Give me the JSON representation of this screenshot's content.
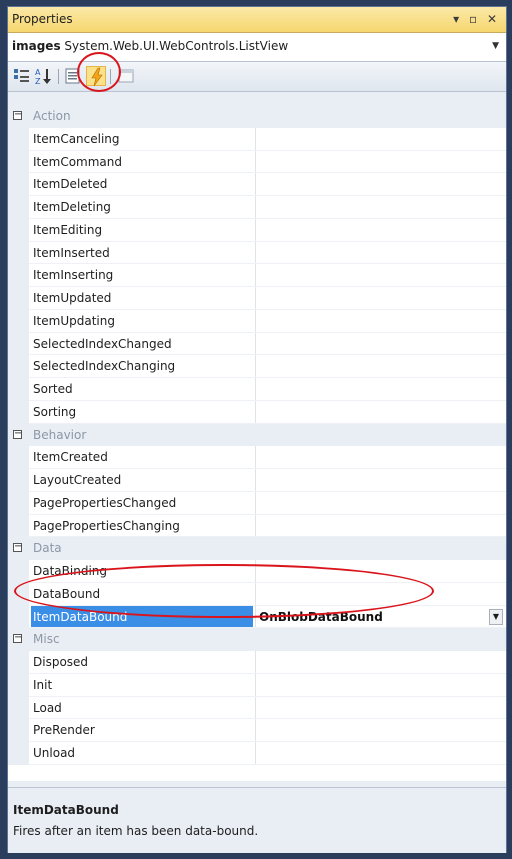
{
  "window": {
    "title": "Properties",
    "controls": "▾ ▫ ✕"
  },
  "object_selector": {
    "name": "images",
    "type": "System.Web.UI.WebControls.ListView"
  },
  "toolbar": {
    "buttons": [
      "categorized-icon",
      "alphabetical-icon",
      "properties-icon",
      "events-icon",
      "property-pages-icon"
    ],
    "active": "events-icon"
  },
  "grid": {
    "categories": [
      {
        "label": "Action",
        "items": [
          {
            "name": "ItemCanceling",
            "value": ""
          },
          {
            "name": "ItemCommand",
            "value": ""
          },
          {
            "name": "ItemDeleted",
            "value": ""
          },
          {
            "name": "ItemDeleting",
            "value": ""
          },
          {
            "name": "ItemEditing",
            "value": ""
          },
          {
            "name": "ItemInserted",
            "value": ""
          },
          {
            "name": "ItemInserting",
            "value": ""
          },
          {
            "name": "ItemUpdated",
            "value": ""
          },
          {
            "name": "ItemUpdating",
            "value": ""
          },
          {
            "name": "SelectedIndexChanged",
            "value": ""
          },
          {
            "name": "SelectedIndexChanging",
            "value": ""
          },
          {
            "name": "Sorted",
            "value": ""
          },
          {
            "name": "Sorting",
            "value": ""
          }
        ]
      },
      {
        "label": "Behavior",
        "items": [
          {
            "name": "ItemCreated",
            "value": ""
          },
          {
            "name": "LayoutCreated",
            "value": ""
          },
          {
            "name": "PagePropertiesChanged",
            "value": ""
          },
          {
            "name": "PagePropertiesChanging",
            "value": ""
          }
        ]
      },
      {
        "label": "Data",
        "items": [
          {
            "name": "DataBinding",
            "value": ""
          },
          {
            "name": "DataBound",
            "value": ""
          },
          {
            "name": "ItemDataBound",
            "value": "OnBlobDataBound",
            "selected": true
          }
        ]
      },
      {
        "label": "Misc",
        "items": [
          {
            "name": "Disposed",
            "value": ""
          },
          {
            "name": "Init",
            "value": ""
          },
          {
            "name": "Load",
            "value": ""
          },
          {
            "name": "PreRender",
            "value": ""
          },
          {
            "name": "Unload",
            "value": ""
          }
        ]
      }
    ]
  },
  "description": {
    "title": "ItemDataBound",
    "text": "Fires after an item has been data-bound."
  },
  "colors": {
    "annotation": "#d9141b",
    "selection": "#3a8ee6",
    "titlebar": "#f6d66e"
  }
}
